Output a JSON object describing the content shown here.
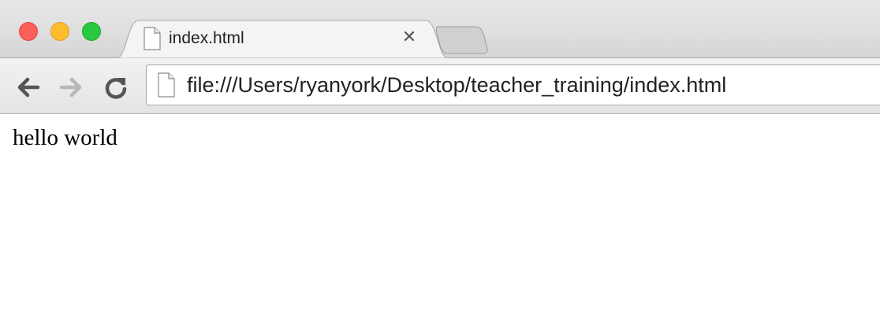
{
  "window": {
    "controls": {
      "close": "close-window",
      "minimize": "minimize-window",
      "maximize": "maximize-window"
    }
  },
  "tabs": [
    {
      "title": "index.html",
      "icon": "document-icon",
      "close_glyph": "✕"
    }
  ],
  "toolbar": {
    "back_icon": "arrow-left-icon",
    "forward_icon": "arrow-right-icon",
    "reload_icon": "reload-icon",
    "address": "file:///Users/ryanyork/Desktop/teacher_training/index.html"
  },
  "page": {
    "body_text": "hello world"
  },
  "colors": {
    "close": "#fc5f57",
    "minimize": "#fdbc2e",
    "maximize": "#28c840"
  }
}
